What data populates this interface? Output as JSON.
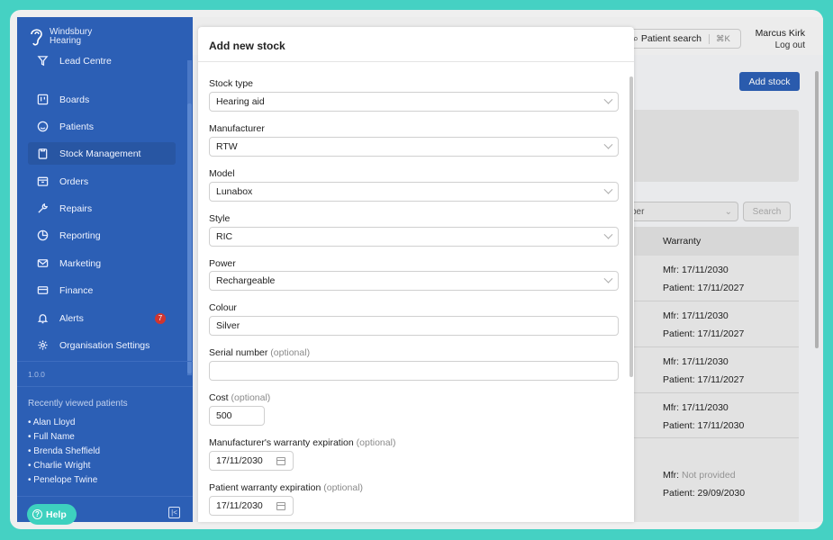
{
  "brand": {
    "line1": "Windsbury",
    "line2": "Hearing"
  },
  "sidebar": {
    "items": [
      {
        "label": "Lead Centre",
        "icon": "funnel-icon"
      },
      {
        "label": "Boards",
        "icon": "kanban-icon"
      },
      {
        "label": "Patients",
        "icon": "smiley-icon"
      },
      {
        "label": "Stock Management",
        "icon": "clipboard-icon",
        "active": true
      },
      {
        "label": "Orders",
        "icon": "box-icon"
      },
      {
        "label": "Repairs",
        "icon": "wrench-icon"
      },
      {
        "label": "Reporting",
        "icon": "pie-chart-icon"
      },
      {
        "label": "Marketing",
        "icon": "envelope-icon"
      },
      {
        "label": "Finance",
        "icon": "credit-card-icon"
      },
      {
        "label": "Alerts",
        "icon": "bell-icon",
        "badge": "7"
      },
      {
        "label": "Organisation Settings",
        "icon": "gear-icon"
      }
    ],
    "version": "1.0.0",
    "recent_title": "Recently viewed patients",
    "recent": [
      "• Alan Lloyd",
      "• Full Name",
      "• Brenda Sheffield",
      "• Charlie Wright",
      "• Penelope Twine"
    ],
    "help_label": "Help"
  },
  "topbar": {
    "search_label": "Patient search",
    "search_shortcut": "⌘K",
    "user_name": "Marcus Kirk",
    "logout_label": "Log out"
  },
  "page": {
    "add_stock_label": "Add stock",
    "filter_value": "ber",
    "search_button": "Search",
    "warranty_header": "Warranty",
    "rows": [
      {
        "mfr": "Mfr: 17/11/2030",
        "patient": "Patient: 17/11/2027"
      },
      {
        "mfr": "Mfr: 17/11/2030",
        "patient": "Patient: 17/11/2027"
      },
      {
        "mfr": "Mfr: 17/11/2030",
        "patient": "Patient: 17/11/2027"
      },
      {
        "mfr": "Mfr: 17/11/2030",
        "patient": "Patient: 17/11/2030"
      }
    ],
    "last_row": {
      "mfr_prefix": "Mfr:",
      "mfr_value": "Not provided",
      "patient": "Patient: 29/09/2030"
    }
  },
  "modal": {
    "title": "Add new stock",
    "fields": {
      "stock_type": {
        "label": "Stock type",
        "value": "Hearing aid"
      },
      "manufacturer": {
        "label": "Manufacturer",
        "value": "RTW"
      },
      "model": {
        "label": "Model",
        "value": "Lunabox"
      },
      "style": {
        "label": "Style",
        "value": "RIC"
      },
      "power": {
        "label": "Power",
        "value": "Rechargeable"
      },
      "colour": {
        "label": "Colour",
        "value": "Silver"
      },
      "serial": {
        "label": "Serial number",
        "optional": "(optional)",
        "value": ""
      },
      "cost": {
        "label": "Cost",
        "optional": "(optional)",
        "value": "500"
      },
      "mfr_warranty": {
        "label": "Manufacturer's warranty expiration",
        "optional": "(optional)",
        "value": "17/11/2030"
      },
      "patient_warranty": {
        "label": "Patient warranty expiration",
        "optional": "(optional)",
        "value": "17/11/2030"
      }
    }
  },
  "colors": {
    "sidebar": "#2c5fb5",
    "accent": "#3dd1bf",
    "badge": "#d0352f",
    "background": "#45d1c3"
  }
}
